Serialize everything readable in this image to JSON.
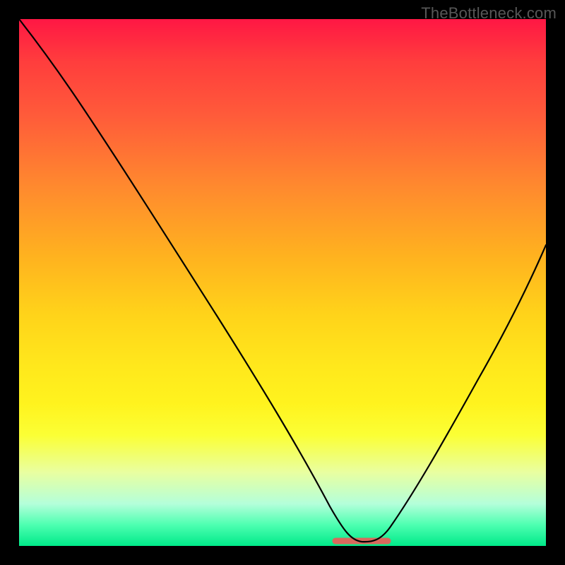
{
  "watermark": "TheBottleneck.com",
  "colors": {
    "background": "#000000",
    "gradient_top": "#ff1744",
    "gradient_bottom": "#00e989",
    "curve": "#000000",
    "trough_marker": "#d9695d",
    "watermark_text": "#575757"
  },
  "chart_data": {
    "type": "line",
    "title": "",
    "xlabel": "",
    "ylabel": "",
    "xlim": [
      0,
      100
    ],
    "ylim": [
      0,
      100
    ],
    "x": [
      0,
      5,
      10,
      15,
      20,
      25,
      30,
      35,
      40,
      45,
      50,
      55,
      60,
      62,
      65,
      68,
      70,
      75,
      80,
      85,
      90,
      95,
      100
    ],
    "values": [
      100,
      96,
      90,
      82,
      74,
      66,
      57,
      48,
      39,
      30,
      21,
      13,
      6,
      3,
      1,
      1,
      3,
      10,
      20,
      31,
      42,
      50,
      58
    ],
    "trough_range_x": [
      60,
      70
    ],
    "trough_value": 1,
    "note": "Values read off a chart with no axes or tick labels; x and y normalized 0-100 by pixel position. Curve descends from top-left, bottoms out near x≈63-67, then rises to the right edge at roughly 58% height."
  }
}
